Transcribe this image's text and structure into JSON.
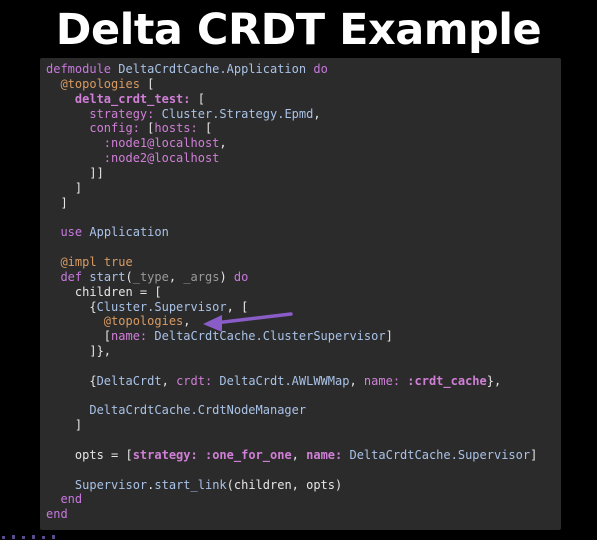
{
  "slide": {
    "title": "Delta CRDT Example"
  },
  "colors": {
    "background": "#000000",
    "code_panel": "#2b2b2c",
    "text": "#e6e6e6",
    "keyword": "#c778dd",
    "module": "#a9c2e6",
    "attribute": "#d99b62",
    "atom_key": "#d07fd6",
    "arrow": "#8a5cc8"
  },
  "code": {
    "lines": [
      [
        {
          "t": "defmodule",
          "c": "kw"
        },
        {
          "t": " "
        },
        {
          "t": "DeltaCrdtCache.Application",
          "c": "mod"
        },
        {
          "t": " "
        },
        {
          "t": "do",
          "c": "kw"
        }
      ],
      [
        {
          "t": "  "
        },
        {
          "t": "@topologies",
          "c": "attr"
        },
        {
          "t": " ["
        }
      ],
      [
        {
          "t": "    "
        },
        {
          "t": "delta_crdt_test:",
          "c": "key"
        },
        {
          "t": " ["
        }
      ],
      [
        {
          "t": "      "
        },
        {
          "t": "strategy:",
          "c": "atom"
        },
        {
          "t": " "
        },
        {
          "t": "Cluster.Strategy.Epmd",
          "c": "mod"
        },
        {
          "t": ","
        }
      ],
      [
        {
          "t": "      "
        },
        {
          "t": "config:",
          "c": "atom"
        },
        {
          "t": " ["
        },
        {
          "t": "hosts:",
          "c": "atom"
        },
        {
          "t": " ["
        }
      ],
      [
        {
          "t": "        "
        },
        {
          "t": ":node1@localhost",
          "c": "atom"
        },
        {
          "t": ","
        }
      ],
      [
        {
          "t": "        "
        },
        {
          "t": ":node2@localhost",
          "c": "atom"
        }
      ],
      [
        {
          "t": "      ]]"
        }
      ],
      [
        {
          "t": "    ]"
        }
      ],
      [
        {
          "t": "  ]"
        }
      ],
      [
        {
          "t": ""
        }
      ],
      [
        {
          "t": "  "
        },
        {
          "t": "use",
          "c": "kw"
        },
        {
          "t": " "
        },
        {
          "t": "Application",
          "c": "mod"
        }
      ],
      [
        {
          "t": ""
        }
      ],
      [
        {
          "t": "  "
        },
        {
          "t": "@impl",
          "c": "attr"
        },
        {
          "t": " "
        },
        {
          "t": "true",
          "c": "bool"
        }
      ],
      [
        {
          "t": "  "
        },
        {
          "t": "def",
          "c": "kw"
        },
        {
          "t": " "
        },
        {
          "t": "start",
          "c": "fn"
        },
        {
          "t": "("
        },
        {
          "t": "_type",
          "c": "var"
        },
        {
          "t": ", "
        },
        {
          "t": "_args",
          "c": "var"
        },
        {
          "t": ") "
        },
        {
          "t": "do",
          "c": "kw"
        }
      ],
      [
        {
          "t": "    children = ["
        }
      ],
      [
        {
          "t": "      {"
        },
        {
          "t": "Cluster.Supervisor",
          "c": "mod"
        },
        {
          "t": ", ["
        }
      ],
      [
        {
          "t": "        "
        },
        {
          "t": "@topologies",
          "c": "attr"
        },
        {
          "t": ","
        }
      ],
      [
        {
          "t": "        ["
        },
        {
          "t": "name:",
          "c": "atom"
        },
        {
          "t": " "
        },
        {
          "t": "DeltaCrdtCache.ClusterSupervisor",
          "c": "mod"
        },
        {
          "t": "]"
        }
      ],
      [
        {
          "t": "      ]},"
        }
      ],
      [
        {
          "t": ""
        }
      ],
      [
        {
          "t": "      {"
        },
        {
          "t": "DeltaCrdt",
          "c": "mod"
        },
        {
          "t": ", "
        },
        {
          "t": "crdt:",
          "c": "atom"
        },
        {
          "t": " "
        },
        {
          "t": "DeltaCrdt.AWLWWMap",
          "c": "mod"
        },
        {
          "t": ", "
        },
        {
          "t": "name:",
          "c": "atom"
        },
        {
          "t": " "
        },
        {
          "t": ":crdt_cache",
          "c": "key"
        },
        {
          "t": "},"
        }
      ],
      [
        {
          "t": ""
        }
      ],
      [
        {
          "t": "      "
        },
        {
          "t": "DeltaCrdtCache.CrdtNodeManager",
          "c": "mod"
        }
      ],
      [
        {
          "t": "    ]"
        }
      ],
      [
        {
          "t": ""
        }
      ],
      [
        {
          "t": "    opts = ["
        },
        {
          "t": "strategy:",
          "c": "key"
        },
        {
          "t": " "
        },
        {
          "t": ":one_for_one",
          "c": "key"
        },
        {
          "t": ", "
        },
        {
          "t": "name:",
          "c": "key"
        },
        {
          "t": " "
        },
        {
          "t": "DeltaCrdtCache.Supervisor",
          "c": "mod"
        },
        {
          "t": "]"
        }
      ],
      [
        {
          "t": ""
        }
      ],
      [
        {
          "t": "    "
        },
        {
          "t": "Supervisor",
          "c": "mod"
        },
        {
          "t": "."
        },
        {
          "t": "start_link",
          "c": "fn"
        },
        {
          "t": "(children, opts)"
        }
      ],
      [
        {
          "t": "  "
        },
        {
          "t": "end",
          "c": "kw"
        }
      ],
      [
        {
          "t": "end",
          "c": "kw"
        }
      ]
    ]
  }
}
